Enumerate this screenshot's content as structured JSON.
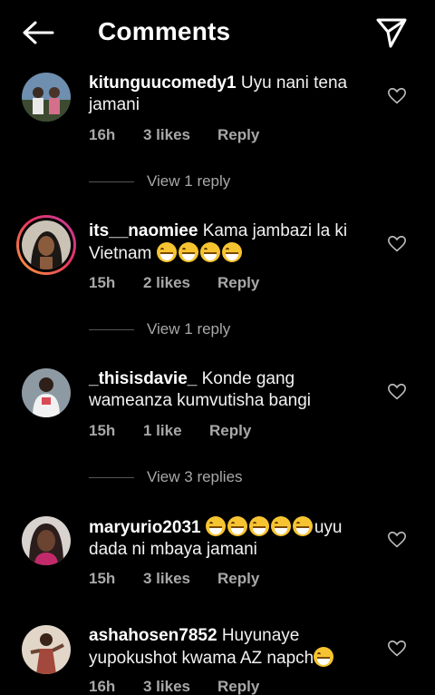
{
  "header": {
    "title": "Comments",
    "back_icon": "arrow-left-icon",
    "send_icon": "paper-plane-icon"
  },
  "comments": [
    {
      "username": "kitunguucomedy1",
      "text": "Uyu nani tena jamani",
      "time": "16h",
      "likes": "3 likes",
      "reply": "Reply",
      "view_replies": "View 1 reply"
    },
    {
      "username": "its__naomiee",
      "text": "Kama jambazi la ki Vietnam",
      "emoji_count": 4,
      "time": "15h",
      "likes": "2 likes",
      "reply": "Reply",
      "view_replies": "View 1 reply",
      "has_story": true
    },
    {
      "username": "_thisisdavie_",
      "text": "Konde gang wameanza kumvutisha bangi",
      "time": "15h",
      "likes": "1 like",
      "reply": "Reply",
      "view_replies": "View 3 replies"
    },
    {
      "username": "maryurio2031",
      "emoji_count": 5,
      "text": "uyu dada ni mbaya jamani",
      "time": "15h",
      "likes": "3 likes",
      "reply": "Reply"
    },
    {
      "username": "ashahosen7852",
      "text": "Huyunaye yupokushot kwama AZ napch",
      "emoji_count": 1,
      "time": "16h",
      "likes": "3 likes",
      "reply": "Reply"
    }
  ],
  "colors": {
    "background": "#000000",
    "text": "#ffffff",
    "muted": "#a8a8a8",
    "story_ring_start": "#f9a13a",
    "story_ring_end": "#c13aa2"
  }
}
